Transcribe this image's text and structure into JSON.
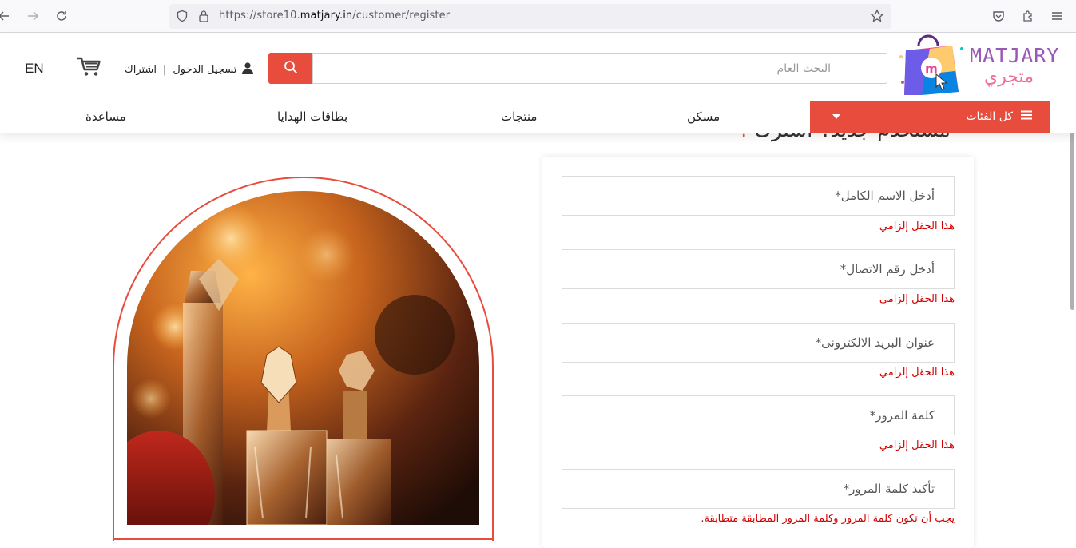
{
  "browser": {
    "url_prefix": "https://store10.",
    "url_domain": "matjary.in",
    "url_path": "/customer/register"
  },
  "header": {
    "lang": "EN",
    "login_label": "تسجيل الدخول",
    "signup_label": "اشتراك",
    "separator": "|",
    "search_placeholder": "البحث العام",
    "logo_en": "MATJARY",
    "logo_ar": "متجري"
  },
  "nav": {
    "categories_label": "كل الفئات",
    "items": [
      "مسكن",
      "منتجات",
      "بطاقات الهدايا",
      "مساعدة"
    ]
  },
  "page": {
    "title": "مستخدم جديد؟ اشترك",
    "title_mark": "!"
  },
  "form": {
    "fields": [
      {
        "placeholder": "أدخل الاسم الكامل*",
        "error": "هذا الحقل إلزامي"
      },
      {
        "placeholder": "أدخل رقم الاتصال*",
        "error": "هذا الحقل إلزامي"
      },
      {
        "placeholder": "عنوان البريد الالكترونى*",
        "error": "هذا الحقل إلزامي"
      },
      {
        "placeholder": "كلمة المرور*",
        "error": "هذا الحقل إلزامي"
      },
      {
        "placeholder": "تأكيد كلمة المرور*",
        "error": "يجب أن تكون كلمة المرور وكلمة المرور المطابقة متطابقة."
      }
    ]
  },
  "colors": {
    "accent": "#e84c3d",
    "error": "#d40000"
  },
  "icons": {
    "back": "arrow-left-icon",
    "forward": "arrow-right-icon",
    "reload": "reload-icon",
    "shield": "shield-icon",
    "lock": "lock-icon",
    "star": "star-icon",
    "pocket": "pocket-icon",
    "extensions": "puzzle-icon",
    "menu": "hamburger-icon",
    "cart": "cart-icon",
    "user": "user-icon",
    "search": "search-icon"
  }
}
